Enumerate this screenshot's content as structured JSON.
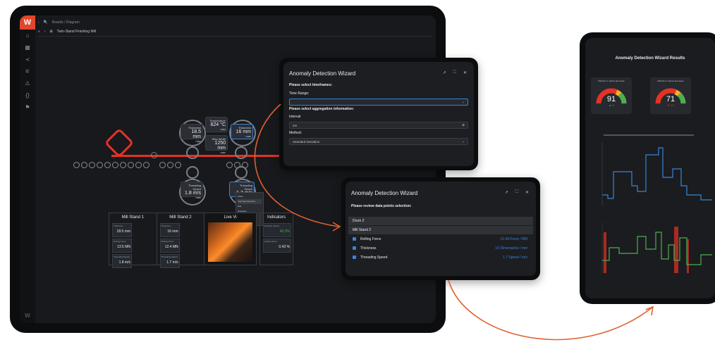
{
  "app": {
    "breadcrumb": "Boards / Diagram",
    "page": "Twin-Stand Finishing Mill"
  },
  "sidebar": {
    "icons": [
      "logo-icon",
      "home-icon",
      "grid-icon",
      "share-icon",
      "filter-icon",
      "alert-icon",
      "code-icon",
      "flag-icon"
    ]
  },
  "gauges": {
    "thickness1": {
      "label": "Thickness",
      "value": "18.5 mm",
      "unit": "max"
    },
    "temperature": {
      "label": "Temperature",
      "value": "824 °C",
      "unit": "max"
    },
    "thickness2": {
      "label": "Thickness",
      "value": "16 mm",
      "unit": "max"
    },
    "strip_width": {
      "label": "Strip Width",
      "value": "1250 mm",
      "unit": "max"
    },
    "threading1": {
      "label": "Threading Speed",
      "value": "1.8 m/s",
      "unit": "max"
    },
    "threading2": {
      "label": "Threading Speed",
      "value": "1.7 m/s",
      "unit": "max"
    }
  },
  "context_menu": [
    "Share",
    "Anomaly Detection",
    "Edit",
    "Duplicate",
    "Delete",
    "Alignment"
  ],
  "panels": {
    "mill1": {
      "title": "Mill Stand 1",
      "cells": [
        {
          "label": "Thickness",
          "value": "18.5 mm"
        },
        {
          "label": "Rolling Force",
          "value": "13.5 MN"
        },
        {
          "label": "Threading Speed",
          "value": "1.8 m/s"
        }
      ]
    },
    "mill2": {
      "title": "Mill Stand 2",
      "cells": [
        {
          "label": "Thickness",
          "value": "16 mm"
        },
        {
          "label": "Rolling Force",
          "value": "12.4 MN"
        },
        {
          "label": "Threading Speed",
          "value": "1.7 m/s"
        }
      ]
    },
    "live": {
      "title": "Live Vi"
    },
    "indicators": {
      "title": "Indicators",
      "items": [
        {
          "label": "Network Uptime",
          "value": "42.3%"
        },
        {
          "label": "Quality Score",
          "value": "0.43 %"
        }
      ]
    }
  },
  "wizard1": {
    "title": "Anomaly Detection Wizard",
    "timeframes_heading": "Please select timeframes:",
    "time_range_label": "Time Range:",
    "time_range_value": "",
    "aggregation_heading": "Please select aggregation information:",
    "interval_label": "Interval",
    "interval_value": "2m",
    "method_label": "Method:",
    "method_value": "Standard Deviation"
  },
  "wizard2": {
    "title": "Anomaly Detection Wizard",
    "heading": "Please review data points selection:",
    "groups": [
      "Drum 2",
      "Mill Stand 2"
    ],
    "items": [
      {
        "label": "Rolling Force",
        "value": "12.49 Force / MN"
      },
      {
        "label": "Thickness",
        "value": "16 Dimensions / mm"
      },
      {
        "label": "Threading Speed",
        "value": "1.7 Speed / m/s"
      }
    ]
  },
  "results": {
    "title": "Anomaly Detection Wizard Results",
    "gauge1": {
      "label": "Machine 1 uptime last week",
      "value": "91",
      "delta": "▲ 4"
    },
    "gauge2": {
      "label": "Machine 2 uptime last week",
      "value": "71",
      "delta": "▼ 16"
    },
    "accent_blue": "#3a84d6",
    "accent_green": "#4caf50",
    "accent_red": "#e53225"
  }
}
